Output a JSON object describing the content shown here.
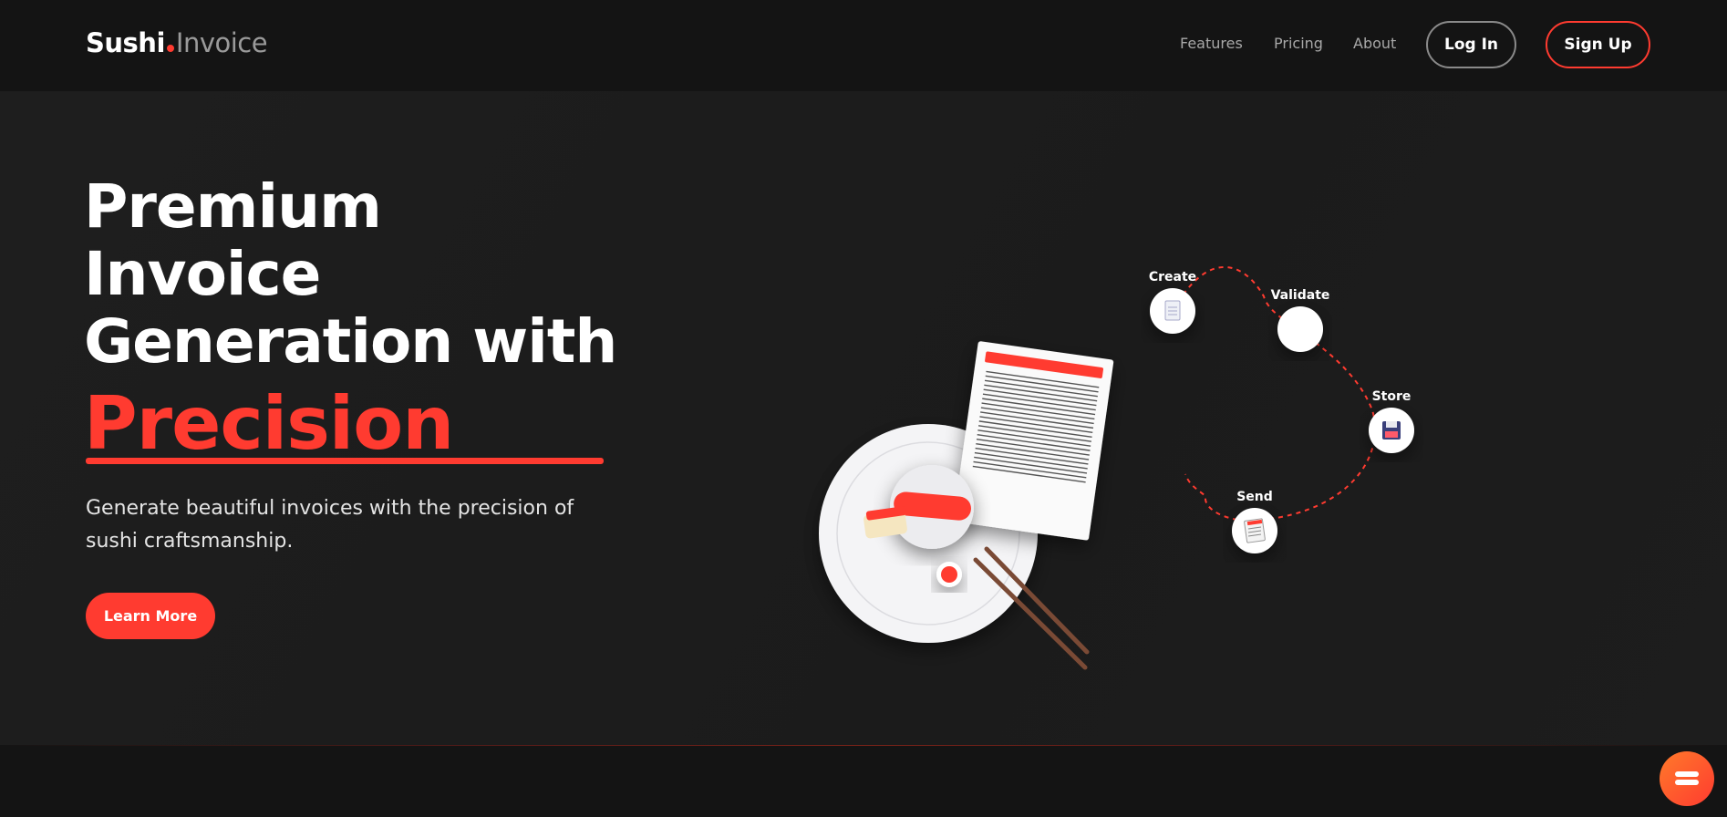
{
  "nav": {
    "brand": "Sushi",
    "product": "Invoice",
    "links": [
      "Features",
      "Pricing",
      "About"
    ],
    "login_label": "Log In",
    "signup_label": "Sign Up"
  },
  "hero": {
    "headline_line1": "Premium",
    "headline_line2": "Invoice",
    "headline_line3": "Generation with",
    "highlight": "Precision",
    "subtitle": "Generate beautiful invoices with the precision of sushi craftsmanship.",
    "cta_label": "Learn More"
  },
  "workflow": {
    "steps": [
      {
        "label": "Create",
        "icon": "document-icon"
      },
      {
        "label": "Validate",
        "icon": "blank-circle-icon"
      },
      {
        "label": "Store",
        "icon": "floppy-disk-icon"
      },
      {
        "label": "Send",
        "icon": "invoice-icon"
      }
    ]
  },
  "fab": {
    "icon": "sushi-icon"
  },
  "colors": {
    "accent": "#ff3b30",
    "background": "#1c1c1c",
    "nav": "#141414"
  }
}
